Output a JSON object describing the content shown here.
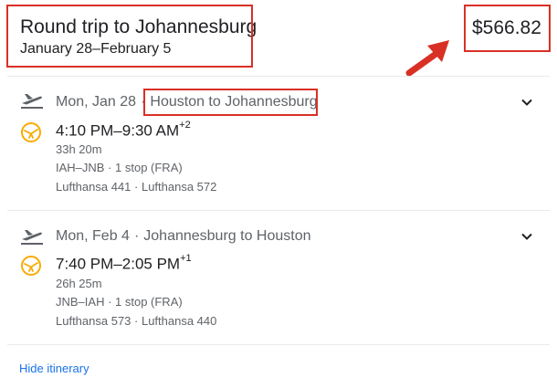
{
  "trip": {
    "title": "Round trip to Johannesburg",
    "dates": "January 28–February 5",
    "price": "$566.82"
  },
  "legs": [
    {
      "date": "Mon, Jan 28",
      "route": "Houston to Johannesburg",
      "times": "4:10 PM–9:30 AM",
      "day_offset": "+2",
      "duration": "33h 20m",
      "stops": "IAH–JNB · 1 stop (FRA)",
      "flights": "Lufthansa 441 · Lufthansa 572",
      "icon": "takeoff-icon",
      "airline_icon": "lufthansa-logo-icon"
    },
    {
      "date": "Mon, Feb 4",
      "route": "Johannesburg to Houston",
      "times": "7:40 PM–2:05 PM",
      "day_offset": "+1",
      "duration": "26h 25m",
      "stops": "JNB–IAH · 1 stop (FRA)",
      "flights": "Lufthansa 573 · Lufthansa 440",
      "icon": "takeoff-icon",
      "airline_icon": "lufthansa-logo-icon"
    }
  ],
  "footer": {
    "hide_itinerary": "Hide itinerary"
  },
  "colors": {
    "highlight_red": "#d93025",
    "link_blue": "#1a73e8",
    "lufthansa_yellow": "#f9ab00",
    "secondary_text": "#5f6368"
  },
  "sep": "·"
}
